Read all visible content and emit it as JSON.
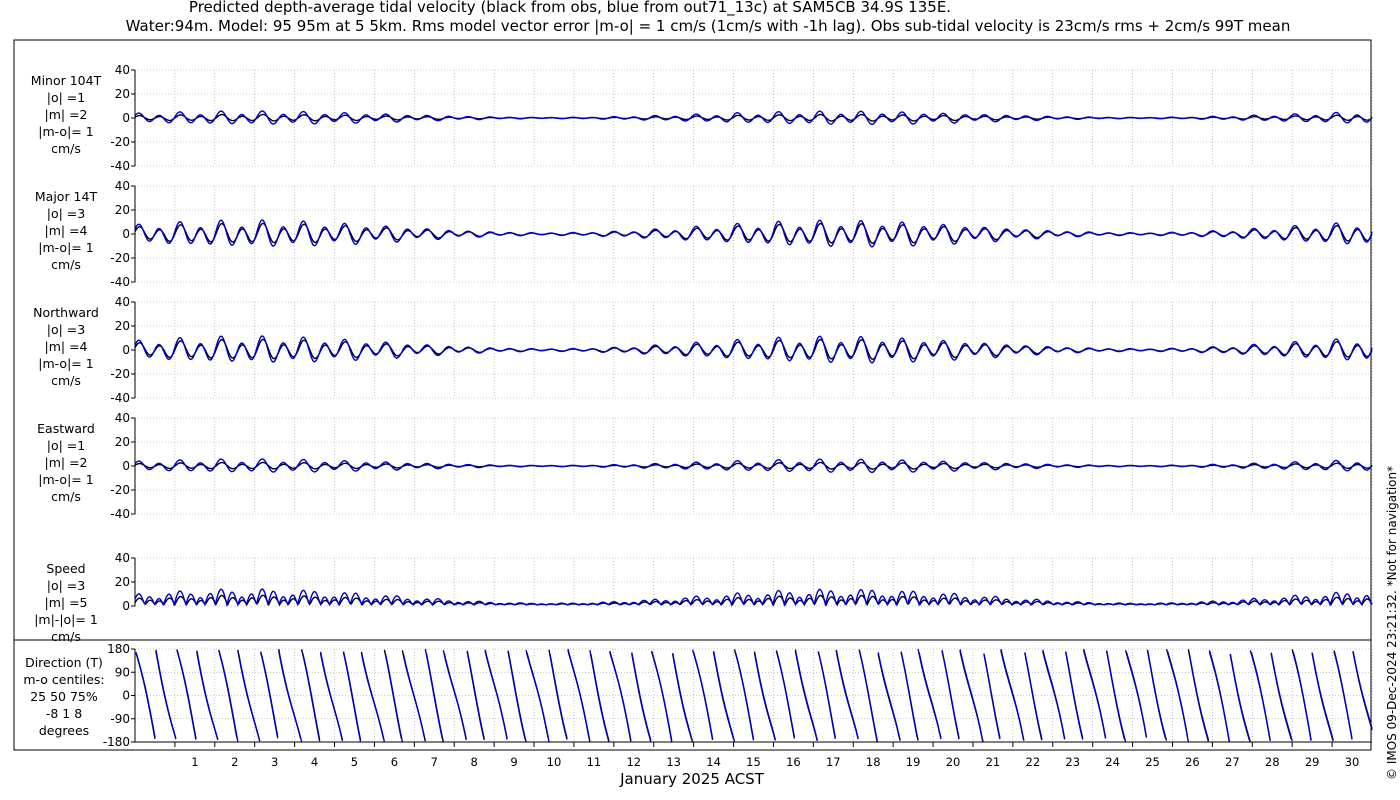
{
  "title_line1": "Predicted depth-average tidal velocity (black from obs, blue from out71_13c) at SAM5CB 34.9S 135E.",
  "title_line2": "Water:94m. Model: 95 95m at 5 5km. Rms model vector error |m-o| = 1 cm/s (1cm/s with -1h lag). Obs sub-tidal velocity is 23cm/s rms + 2cm/s 99T mean",
  "credit": "© IMOS 09-Dec-2024 23:21:32. *Not for navigation*",
  "colors": {
    "obs": "#000000",
    "model": "#0000cc",
    "grid": "#9a9a9a"
  },
  "chart_data": [
    {
      "type": "line",
      "panel": "minor",
      "label_lines": [
        "Minor 104T",
        "|o| =1",
        "|m| =2",
        "|m-o|= 1",
        "cm/s"
      ],
      "ylim": [
        -40,
        40
      ],
      "yticks": [
        -40,
        -20,
        0,
        20,
        40
      ],
      "yticklabels": [
        "-40",
        "-20",
        "0",
        "20",
        "40"
      ],
      "amplitude": {
        "obs": 1,
        "model": 2
      },
      "series": []
    },
    {
      "type": "line",
      "panel": "major",
      "label_lines": [
        "Major 14T",
        "|o| =3",
        "|m| =4",
        "|m-o|= 1",
        "cm/s"
      ],
      "ylim": [
        -40,
        40
      ],
      "yticks": [
        -40,
        -20,
        0,
        20,
        40
      ],
      "yticklabels": [
        "-40",
        "-20",
        "0",
        "20",
        "40"
      ],
      "amplitude": {
        "obs": 3,
        "model": 4
      },
      "series": []
    },
    {
      "type": "line",
      "panel": "north",
      "label_lines": [
        "Northward",
        "|o| =3",
        "|m| =4",
        "|m-o|= 1",
        "cm/s"
      ],
      "ylim": [
        -40,
        40
      ],
      "yticks": [
        -40,
        -20,
        0,
        20,
        40
      ],
      "yticklabels": [
        "-40",
        "-20",
        "0",
        "20",
        "40"
      ],
      "amplitude": {
        "obs": 3,
        "model": 4
      },
      "series": []
    },
    {
      "type": "line",
      "panel": "east",
      "label_lines": [
        "Eastward",
        "|o| =1",
        "|m| =2",
        "|m-o|= 1",
        "cm/s"
      ],
      "ylim": [
        -40,
        40
      ],
      "yticks": [
        -40,
        -20,
        0,
        20,
        40
      ],
      "yticklabels": [
        "-40",
        "-20",
        "0",
        "20",
        "40"
      ],
      "amplitude": {
        "obs": 1,
        "model": 2
      },
      "series": []
    },
    {
      "type": "line",
      "panel": "speed",
      "label_lines": [
        "Speed",
        "|o| =3",
        "|m| =5",
        "|m|-|o|= 1",
        "cm/s"
      ],
      "ylim": [
        0,
        40
      ],
      "yticks": [
        0,
        20,
        40
      ],
      "yticklabels": [
        "0",
        "20",
        "40"
      ],
      "amplitude": {
        "obs": 3,
        "model": 5
      },
      "series": []
    },
    {
      "type": "line",
      "panel": "direction",
      "label_lines": [
        "Direction (T)",
        "m-o centiles:",
        "25  50  75%",
        "-8  1  8",
        "degrees"
      ],
      "ylim": [
        -180,
        180
      ],
      "yticks": [
        -180,
        -90,
        0,
        90,
        180
      ],
      "yticklabels": [
        "-180",
        "-90",
        "0",
        "90",
        "180"
      ],
      "series": []
    }
  ],
  "x_axis": {
    "label": "January 2025 ACST",
    "xlim": [
      0,
      31
    ],
    "ticklabels": [
      "1",
      "2",
      "3",
      "4",
      "5",
      "6",
      "7",
      "8",
      "9",
      "10",
      "11",
      "12",
      "13",
      "14",
      "15",
      "16",
      "17",
      "18",
      "19",
      "20",
      "21",
      "22",
      "23",
      "24",
      "25",
      "26",
      "27",
      "28",
      "29",
      "30"
    ]
  }
}
